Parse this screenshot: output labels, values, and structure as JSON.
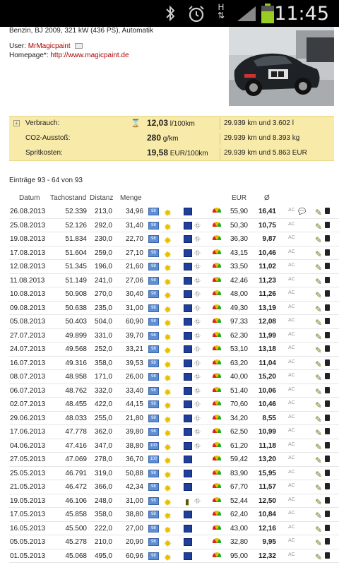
{
  "status_bar": {
    "time": "11:45",
    "icons": [
      "bluetooth-icon",
      "alarm-icon",
      "mobile-data-icon",
      "signal-icon",
      "battery-icon"
    ]
  },
  "vehicle": {
    "description": "Benzin, BJ 2009, 321 kW (436 PS), Automatik",
    "user_label": "User:",
    "user_name": "MrMagicpaint",
    "homepage_label": "Homepage*:",
    "homepage_url": "http://www.magicpaint.de"
  },
  "summary": {
    "rows": [
      {
        "label": "Verbrauch:",
        "value": "12,03",
        "unit": " l/100km",
        "info": "29.939 km und 3.602 l"
      },
      {
        "label": "CO2-Ausstoß:",
        "value": "280",
        "unit": " g/km",
        "info": "29.939 km und 8.393 kg"
      },
      {
        "label": "Spritkosten:",
        "value": "19,58",
        "unit": " EUR/100km",
        "info": "29.939 km und 5.863 EUR"
      }
    ]
  },
  "entries_count": "Einträge 93 - 64 von 93",
  "table": {
    "headers": {
      "date": "Datum",
      "odometer": "Tachostand",
      "distance": "Distanz",
      "quantity": "Menge",
      "eur": "EUR",
      "consumption": "Ø"
    },
    "rows": [
      {
        "date": "26.08.2013",
        "odo": "52.339",
        "dist": "213,0",
        "qty": "34,96",
        "fuel": "98",
        "eur": "55,90",
        "cons": "16,41",
        "road": false,
        "ac": "AC",
        "comment": true
      },
      {
        "date": "25.08.2013",
        "odo": "52.126",
        "dist": "292,0",
        "qty": "31,40",
        "fuel": "98",
        "eur": "50,30",
        "cons": "10,75",
        "road": true,
        "ac": "AC",
        "comment": false
      },
      {
        "date": "19.08.2013",
        "odo": "51.834",
        "dist": "230,0",
        "qty": "22,70",
        "fuel": "98",
        "eur": "36,30",
        "cons": "9,87",
        "road": true,
        "ac": "AC",
        "comment": false
      },
      {
        "date": "17.08.2013",
        "odo": "51.604",
        "dist": "259,0",
        "qty": "27,10",
        "fuel": "98",
        "eur": "43,15",
        "cons": "10,46",
        "road": true,
        "ac": "AC",
        "comment": false
      },
      {
        "date": "12.08.2013",
        "odo": "51.345",
        "dist": "196,0",
        "qty": "21,60",
        "fuel": "98",
        "eur": "33,50",
        "cons": "11,02",
        "road": true,
        "ac": "AC",
        "comment": false
      },
      {
        "date": "11.08.2013",
        "odo": "51.149",
        "dist": "241,0",
        "qty": "27,06",
        "fuel": "98",
        "eur": "42,46",
        "cons": "11,23",
        "road": true,
        "ac": "AC",
        "comment": false
      },
      {
        "date": "10.08.2013",
        "odo": "50.908",
        "dist": "270,0",
        "qty": "30,40",
        "fuel": "98",
        "eur": "48,00",
        "cons": "11,26",
        "road": true,
        "ac": "AC",
        "comment": false
      },
      {
        "date": "09.08.2013",
        "odo": "50.638",
        "dist": "235,0",
        "qty": "31,00",
        "fuel": "98",
        "eur": "49,30",
        "cons": "13,19",
        "road": true,
        "ac": "AC",
        "comment": false
      },
      {
        "date": "05.08.2013",
        "odo": "50.403",
        "dist": "504,0",
        "qty": "60,90",
        "fuel": "98",
        "eur": "97,33",
        "cons": "12,08",
        "road": true,
        "ac": "AC",
        "comment": false
      },
      {
        "date": "27.07.2013",
        "odo": "49.899",
        "dist": "331,0",
        "qty": "39,70",
        "fuel": "98",
        "eur": "62,30",
        "cons": "11,99",
        "road": true,
        "ac": "AC",
        "comment": false
      },
      {
        "date": "24.07.2013",
        "odo": "49.568",
        "dist": "252,0",
        "qty": "33,21",
        "fuel": "98",
        "eur": "53,10",
        "cons": "13,18",
        "road": true,
        "ac": "AC",
        "comment": false
      },
      {
        "date": "16.07.2013",
        "odo": "49.316",
        "dist": "358,0",
        "qty": "39,53",
        "fuel": "98",
        "eur": "63,20",
        "cons": "11,04",
        "road": true,
        "ac": "AC",
        "comment": false
      },
      {
        "date": "08.07.2013",
        "odo": "48.958",
        "dist": "171,0",
        "qty": "26,00",
        "fuel": "98",
        "eur": "40,00",
        "cons": "15,20",
        "road": true,
        "ac": "AC",
        "comment": false
      },
      {
        "date": "06.07.2013",
        "odo": "48.762",
        "dist": "332,0",
        "qty": "33,40",
        "fuel": "98",
        "eur": "51,40",
        "cons": "10,06",
        "road": true,
        "ac": "AC",
        "comment": false
      },
      {
        "date": "02.07.2013",
        "odo": "48.455",
        "dist": "422,0",
        "qty": "44,15",
        "fuel": "98",
        "eur": "70,60",
        "cons": "10,46",
        "road": true,
        "ac": "AC",
        "comment": false
      },
      {
        "date": "29.06.2013",
        "odo": "48.033",
        "dist": "255,0",
        "qty": "21,80",
        "fuel": "98",
        "eur": "34,20",
        "cons": "8,55",
        "road": true,
        "ac": "AC",
        "comment": false
      },
      {
        "date": "17.06.2013",
        "odo": "47.778",
        "dist": "362,0",
        "qty": "39,80",
        "fuel": "98",
        "eur": "62,50",
        "cons": "10,99",
        "road": true,
        "ac": "AC",
        "comment": false
      },
      {
        "date": "04.06.2013",
        "odo": "47.416",
        "dist": "347,0",
        "qty": "38,80",
        "fuel": "100",
        "eur": "61,20",
        "cons": "11,18",
        "road": true,
        "ac": "AC",
        "comment": false
      },
      {
        "date": "27.05.2013",
        "odo": "47.069",
        "dist": "278,0",
        "qty": "36,70",
        "fuel": "100",
        "eur": "59,42",
        "cons": "13,20",
        "road": false,
        "ac": "AC",
        "comment": false
      },
      {
        "date": "25.05.2013",
        "odo": "46.791",
        "dist": "319,0",
        "qty": "50,88",
        "fuel": "98",
        "eur": "83,90",
        "cons": "15,95",
        "road": false,
        "ac": "AC",
        "comment": false
      },
      {
        "date": "21.05.2013",
        "odo": "46.472",
        "dist": "366,0",
        "qty": "42,34",
        "fuel": "98",
        "eur": "67,70",
        "cons": "11,57",
        "road": false,
        "ac": "AC",
        "comment": false
      },
      {
        "date": "19.05.2013",
        "odo": "46.106",
        "dist": "248,0",
        "qty": "31,00",
        "fuel": "98",
        "eur": "52,44",
        "cons": "12,50",
        "road": true,
        "ac": "AC",
        "comment": false,
        "city": true
      },
      {
        "date": "17.05.2013",
        "odo": "45.858",
        "dist": "358,0",
        "qty": "38,80",
        "fuel": "98",
        "eur": "62,40",
        "cons": "10,84",
        "road": false,
        "ac": "AC",
        "comment": false
      },
      {
        "date": "16.05.2013",
        "odo": "45.500",
        "dist": "222,0",
        "qty": "27,00",
        "fuel": "98",
        "eur": "43,00",
        "cons": "12,16",
        "road": false,
        "ac": "AC",
        "comment": false
      },
      {
        "date": "05.05.2013",
        "odo": "45.278",
        "dist": "210,0",
        "qty": "20,90",
        "fuel": "98",
        "eur": "32,80",
        "cons": "9,95",
        "road": false,
        "ac": "AC",
        "comment": false
      },
      {
        "date": "01.05.2013",
        "odo": "45.068",
        "dist": "495,0",
        "qty": "60,96",
        "fuel": "98",
        "eur": "95,00",
        "cons": "12,32",
        "road": false,
        "ac": "AC",
        "comment": false
      }
    ]
  },
  "colors": {
    "summary_bg": "#f8eaa8",
    "link": "#aa0000",
    "fuel_badge": "#5d8fd6",
    "highway": "#1f3f99"
  }
}
